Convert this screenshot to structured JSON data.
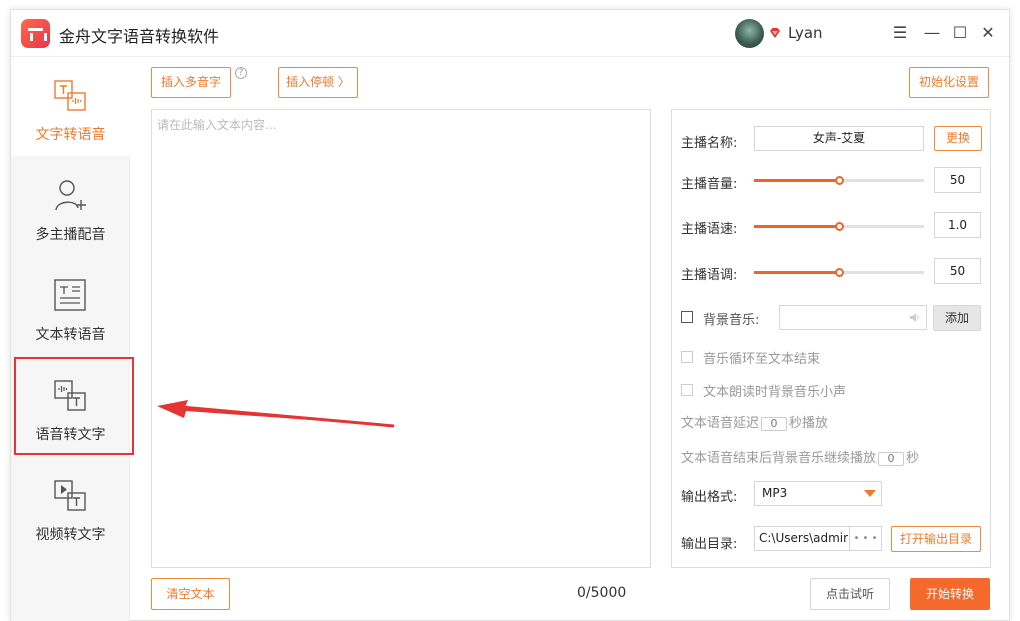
{
  "app": {
    "title": "金舟文字语音转换软件",
    "username": "Lyan"
  },
  "window_controls": {
    "menu": "☰",
    "minimize": "—",
    "maximize": "☐",
    "close": "✕"
  },
  "sidebar": {
    "items": [
      {
        "label": "文字转语音",
        "icon": "text-to-speech-icon",
        "active": true
      },
      {
        "label": "多主播配音",
        "icon": "multi-user-icon",
        "active": false
      },
      {
        "label": "文本转语音",
        "icon": "document-icon",
        "active": false
      },
      {
        "label": "语音转文字",
        "icon": "speech-to-text-icon",
        "active": false
      },
      {
        "label": "视频转文字",
        "icon": "video-to-text-icon",
        "active": false
      }
    ]
  },
  "toolbar": {
    "insert_polyphone": "插入多音字",
    "help": "?",
    "insert_pause": "插入停顿 〉",
    "reset": "初始化设置"
  },
  "editor": {
    "placeholder": "请在此输入文本内容...",
    "count": "0/5000",
    "clear": "清空文本"
  },
  "settings": {
    "anchor_label": "主播名称:",
    "anchor_value": "女声-艾夏",
    "change_button": "更换",
    "volume_label": "主播音量:",
    "volume_value": "50",
    "volume_level": 0.5,
    "speed_label": "主播语速:",
    "speed_value": "1.0",
    "speed_level": 0.5,
    "pitch_label": "主播语调:",
    "pitch_value": "50",
    "pitch_level": 0.5,
    "bgm_label": "背景音乐:",
    "add_button": "添加",
    "loop_label": "音乐循环至文本结束",
    "duck_label": "文本朗读时背景音乐小声",
    "delay_prefix": "文本语音延迟",
    "delay_value": "0",
    "delay_suffix": "秒播放",
    "continue_prefix": "文本语音结束后背景音乐继续播放",
    "continue_value": "0",
    "continue_suffix": "秒",
    "format_label": "输出格式:",
    "format_value": "MP3",
    "dir_label": "输出目录:",
    "dir_value": "C:\\Users\\admir",
    "dir_more": "• • •",
    "open_dir": "打开输出目录"
  },
  "footer": {
    "preview": "点击试听",
    "start": "开始转换"
  },
  "colors": {
    "accent": "#f5692c",
    "annotation": "#e53434"
  }
}
